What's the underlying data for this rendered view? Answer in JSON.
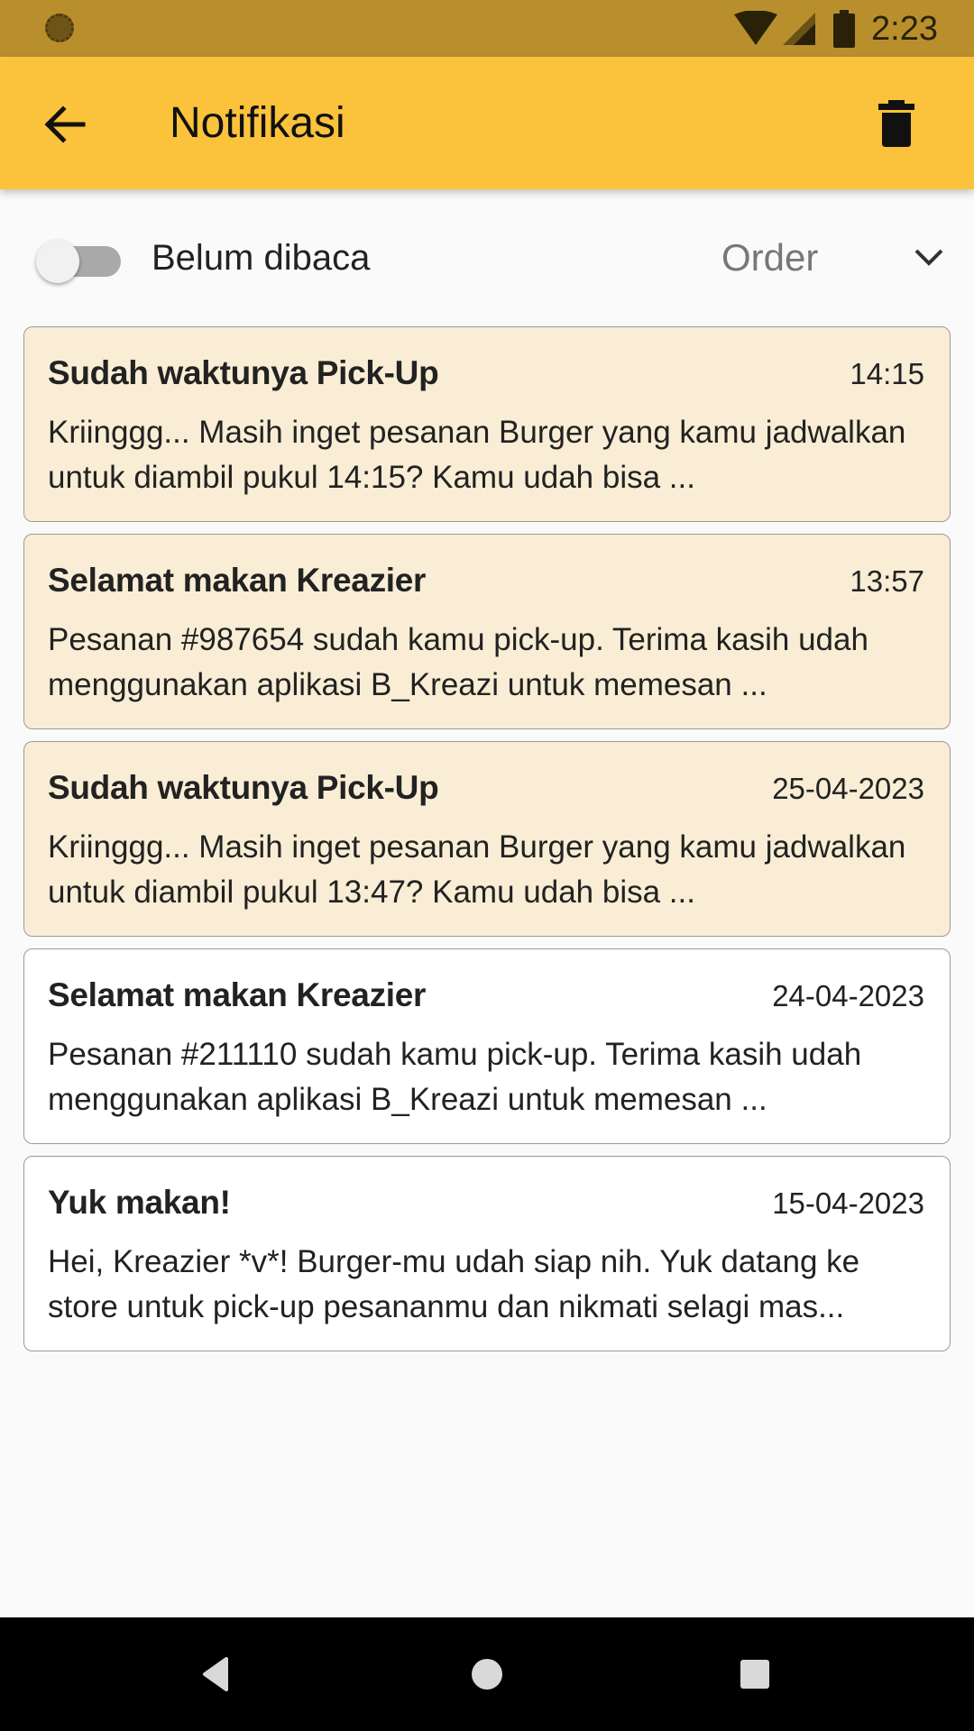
{
  "status_bar": {
    "time": "2:23",
    "icons": [
      "notification-dot-icon",
      "wifi-icon",
      "cell-signal-icon",
      "battery-icon"
    ]
  },
  "app_bar": {
    "title": "Notifikasi",
    "back_icon": "arrow-left-icon",
    "delete_icon": "trash-icon"
  },
  "filter": {
    "toggle_label": "Belum dibaca",
    "toggle_on": false,
    "dropdown_value": "Order"
  },
  "notifications": [
    {
      "title": "Sudah waktunya Pick-Up",
      "time": "14:15",
      "body": "Kriinggg... Masih inget pesanan Burger yang kamu jadwalkan untuk diambil pukul 14:15? Kamu udah bisa ...",
      "unread": true
    },
    {
      "title": "Selamat makan Kreazier",
      "time": "13:57",
      "body": "Pesanan #987654 sudah kamu pick-up. Terima kasih udah menggunakan aplikasi B_Kreazi untuk memesan ...",
      "unread": true
    },
    {
      "title": "Sudah waktunya Pick-Up",
      "time": "25-04-2023",
      "body": "Kriinggg... Masih inget pesanan Burger yang kamu jadwalkan untuk diambil pukul 13:47? Kamu udah bisa ...",
      "unread": true
    },
    {
      "title": "Selamat makan Kreazier",
      "time": "24-04-2023",
      "body": "Pesanan #211110 sudah kamu pick-up. Terima kasih udah menggunakan aplikasi B_Kreazi untuk memesan ...",
      "unread": false
    },
    {
      "title": "Yuk makan!",
      "time": "15-04-2023",
      "body": "Hei, Kreazier *v*! Burger-mu udah siap nih. Yuk datang ke store untuk pick-up pesananmu dan nikmati selagi mas...",
      "unread": false
    }
  ],
  "nav_bar": {
    "icons": [
      "back-triangle-icon",
      "home-circle-icon",
      "recents-square-icon"
    ]
  },
  "colors": {
    "status_bar": "#b98f2e",
    "app_bar": "#fbc23c",
    "unread_card": "#f9edd5",
    "read_card": "#ffffff"
  }
}
